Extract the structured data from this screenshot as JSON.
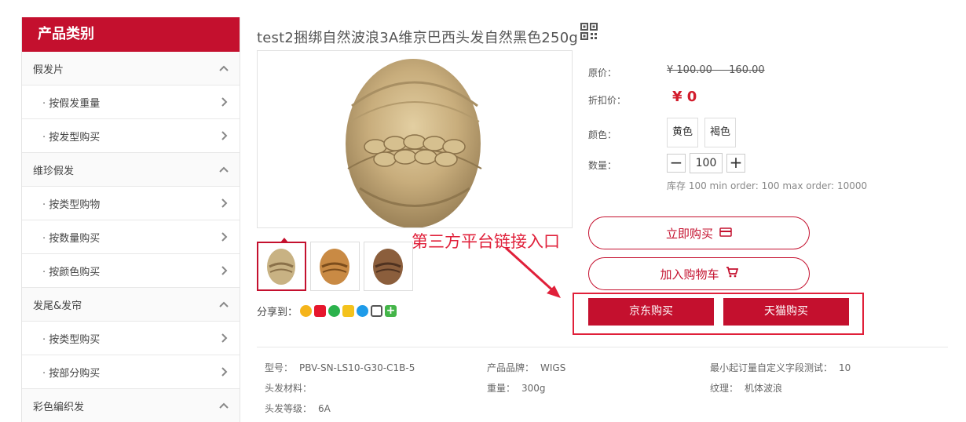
{
  "sidebar": {
    "header": "产品类别",
    "items": [
      {
        "label": "假发片",
        "type": "cat",
        "chevron": "up"
      },
      {
        "label": "按假发重量",
        "type": "sub",
        "chevron": "right"
      },
      {
        "label": "按发型购买",
        "type": "sub",
        "chevron": "right"
      },
      {
        "label": "维珍假发",
        "type": "cat",
        "chevron": "up"
      },
      {
        "label": "按类型购物",
        "type": "sub",
        "chevron": "right"
      },
      {
        "label": "按数量购买",
        "type": "sub",
        "chevron": "right"
      },
      {
        "label": "按颜色购买",
        "type": "sub",
        "chevron": "right"
      },
      {
        "label": "发尾&发帘",
        "type": "cat",
        "chevron": "up"
      },
      {
        "label": "按类型购买",
        "type": "sub",
        "chevron": "right"
      },
      {
        "label": "按部分购买",
        "type": "sub",
        "chevron": "right"
      },
      {
        "label": "彩色编织发",
        "type": "cat",
        "chevron": "up"
      }
    ]
  },
  "product": {
    "title": "test2捆绑自然波浪3A维京巴西头发自然黑色250g",
    "labels": {
      "original": "原价：",
      "discount": "折扣价：",
      "color": "颜色：",
      "quantity": "数量："
    },
    "original_price": "¥ 100.00 — 160.00",
    "discount_price": "¥ 0",
    "colors": [
      "黄色",
      "褐色"
    ],
    "quantity": "100",
    "stock_info": "库存 100 min order: 100 max order: 10000",
    "buy_now": "立即购买",
    "add_cart": "加入购物车",
    "jd_buy": "京东购买",
    "tmall_buy": "天猫购买",
    "share_label": "分享到：",
    "share_icons": [
      "qzone-icon",
      "weibo-icon",
      "wechat-icon",
      "email-icon",
      "qq-icon",
      "print-icon",
      "more-share-icon"
    ]
  },
  "annotation": {
    "text": "第三方平台链接入口",
    "color": "#e0203a"
  },
  "specs": [
    {
      "label": "型号：",
      "value": "PBV-SN-LS10-G30-C1B-5"
    },
    {
      "label": "产品品牌：",
      "value": "WIGS"
    },
    {
      "label": "最小起订量自定义字段测试：",
      "value": "10"
    },
    {
      "label": "头发材料：",
      "value": ""
    },
    {
      "label": "重量：",
      "value": "300g"
    },
    {
      "label": "纹理：",
      "value": "机体波浪"
    },
    {
      "label": "头发等级：",
      "value": "6A"
    }
  ],
  "colors": {
    "brand": "#c4102e"
  }
}
